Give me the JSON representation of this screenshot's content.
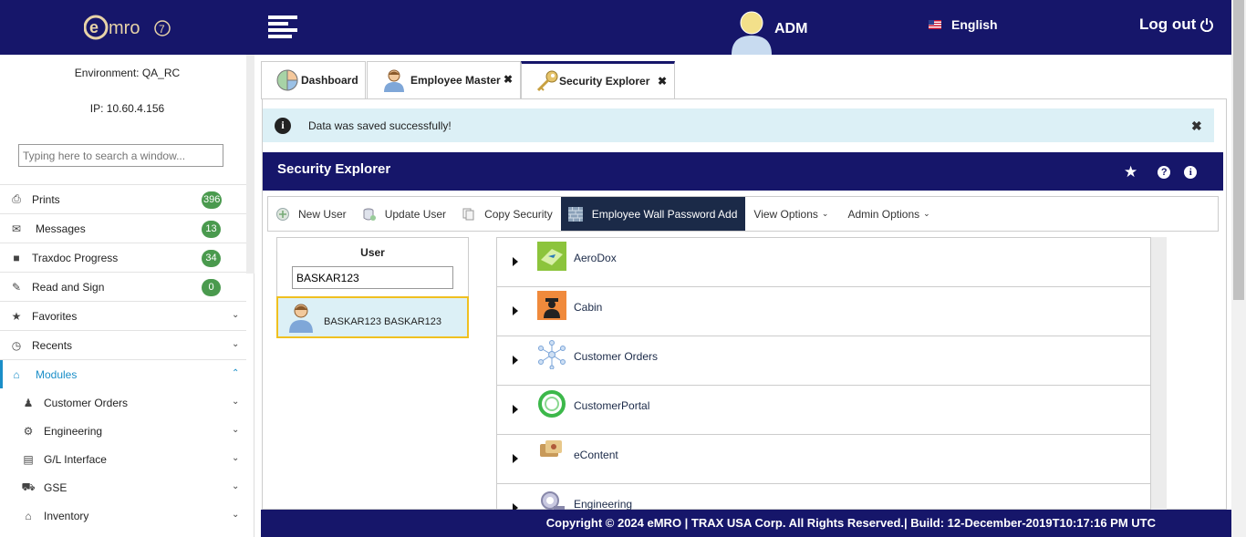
{
  "header": {
    "logo_text": "emro",
    "logo_version": "7",
    "user_name": "ADM",
    "language": "English",
    "logout_label": "Log out"
  },
  "sidebar": {
    "environment": "Environment: QA_RC",
    "ip": "IP: 10.60.4.156",
    "search_placeholder": "Typing here to search a window...",
    "items": [
      {
        "label": "Prints",
        "badge": "396",
        "icon": "print-icon"
      },
      {
        "label": "Messages",
        "badge": "13",
        "icon": "envelope-icon"
      },
      {
        "label": "Traxdoc Progress",
        "badge": "34",
        "icon": "book-icon"
      },
      {
        "label": "Read and Sign",
        "badge": "0",
        "icon": "pencil-icon"
      },
      {
        "label": "Favorites",
        "icon": "star-icon"
      },
      {
        "label": "Recents",
        "icon": "clock-icon"
      },
      {
        "label": "Modules",
        "icon": "home-icon"
      }
    ],
    "modules": [
      {
        "label": "Customer Orders",
        "icon": "users-icon"
      },
      {
        "label": "Engineering",
        "icon": "cog-icon"
      },
      {
        "label": "G/L Interface",
        "icon": "ledger-icon"
      },
      {
        "label": "GSE",
        "icon": "truck-icon"
      },
      {
        "label": "Inventory",
        "icon": "home-icon"
      }
    ]
  },
  "tabs": [
    {
      "label": "Dashboard",
      "icon": "pie-chart-icon"
    },
    {
      "label": "Employee Master",
      "icon": "person-icon"
    },
    {
      "label": "Security Explorer",
      "icon": "key-icon"
    }
  ],
  "alert": {
    "message": "Data was saved successfully!"
  },
  "security_explorer": {
    "title": "Security Explorer",
    "toolbar": {
      "new_user": "New User",
      "update_user": "Update User",
      "copy_security": "Copy Security",
      "employee_wall": "Employee Wall Password Add",
      "view_options": "View Options",
      "admin_options": "Admin Options"
    },
    "user_panel": {
      "header": "User",
      "search_value": "BASKAR123",
      "selected_user": "BASKAR123 BASKAR123"
    },
    "modules": [
      {
        "label": "AeroDox",
        "icon": "aerodox-icon"
      },
      {
        "label": "Cabin",
        "icon": "cabin-icon"
      },
      {
        "label": "Customer Orders",
        "icon": "network-icon"
      },
      {
        "label": "CustomerPortal",
        "icon": "portal-icon"
      },
      {
        "label": "eContent",
        "icon": "econtent-icon"
      },
      {
        "label": "Engineering",
        "icon": "engineering-icon"
      }
    ]
  },
  "footer": {
    "text": "Copyright © 2024 eMRO | TRAX USA Corp. All Rights Reserved.| Build: 12-December-2019T10:17:16 PM UTC"
  }
}
